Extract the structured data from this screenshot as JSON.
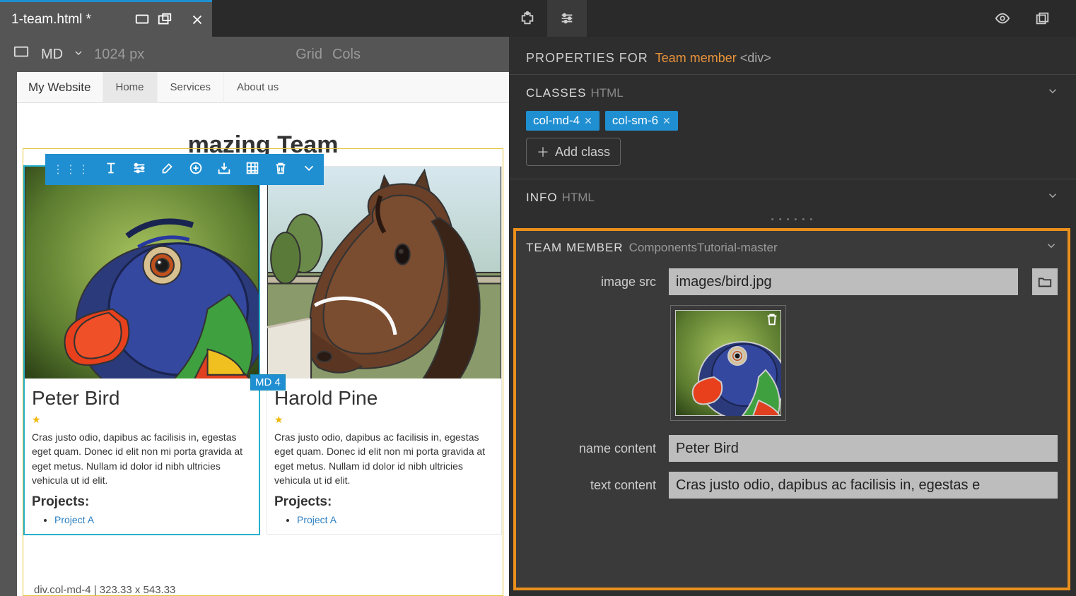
{
  "tab": {
    "filename": "1-team.html *"
  },
  "size_bar": {
    "breakpoint": "MD",
    "px": "1024 px",
    "grid": "Grid",
    "cols": "Cols"
  },
  "site": {
    "brand": "My Website",
    "nav": [
      "Home",
      "Services",
      "About us"
    ]
  },
  "heading": "mazing Team",
  "cards": [
    {
      "name": "Peter Bird",
      "text": "Cras justo odio, dapibus ac facilisis in, egestas eget quam. Donec id elit non mi porta gravida at eget metus. Nullam id dolor id nibh ultricies vehicula ut id elit.",
      "projects_label": "Projects:",
      "project": "Project A"
    },
    {
      "name": "Harold Pine",
      "text": "Cras justo odio, dapibus ac facilisis in, egestas eget quam. Donec id elit non mi porta gravida at eget metus. Nullam id dolor id nibh ultricies vehicula ut id elit.",
      "projects_label": "Projects:",
      "project": "Project A"
    }
  ],
  "md_tag": "MD 4",
  "status_bar": "div.col-md-4    | 323.33 x 543.33",
  "properties": {
    "label": "PROPERTIES FOR",
    "element_name": "Team member",
    "element_tag": "<div>"
  },
  "classes_section": {
    "title": "CLASSES",
    "sub": "HTML",
    "chips": [
      "col-md-4",
      "col-sm-6"
    ],
    "add_label": "Add class"
  },
  "info_section": {
    "title": "INFO",
    "sub": "HTML"
  },
  "team_section": {
    "title": "TEAM MEMBER",
    "sub": "ComponentsTutorial-master",
    "fields": {
      "image_src_label": "image src",
      "image_src_value": "images/bird.jpg",
      "name_label": "name content",
      "name_value": "Peter Bird",
      "text_label": "text content",
      "text_value": "Cras justo odio, dapibus ac facilisis in, egestas e"
    }
  }
}
